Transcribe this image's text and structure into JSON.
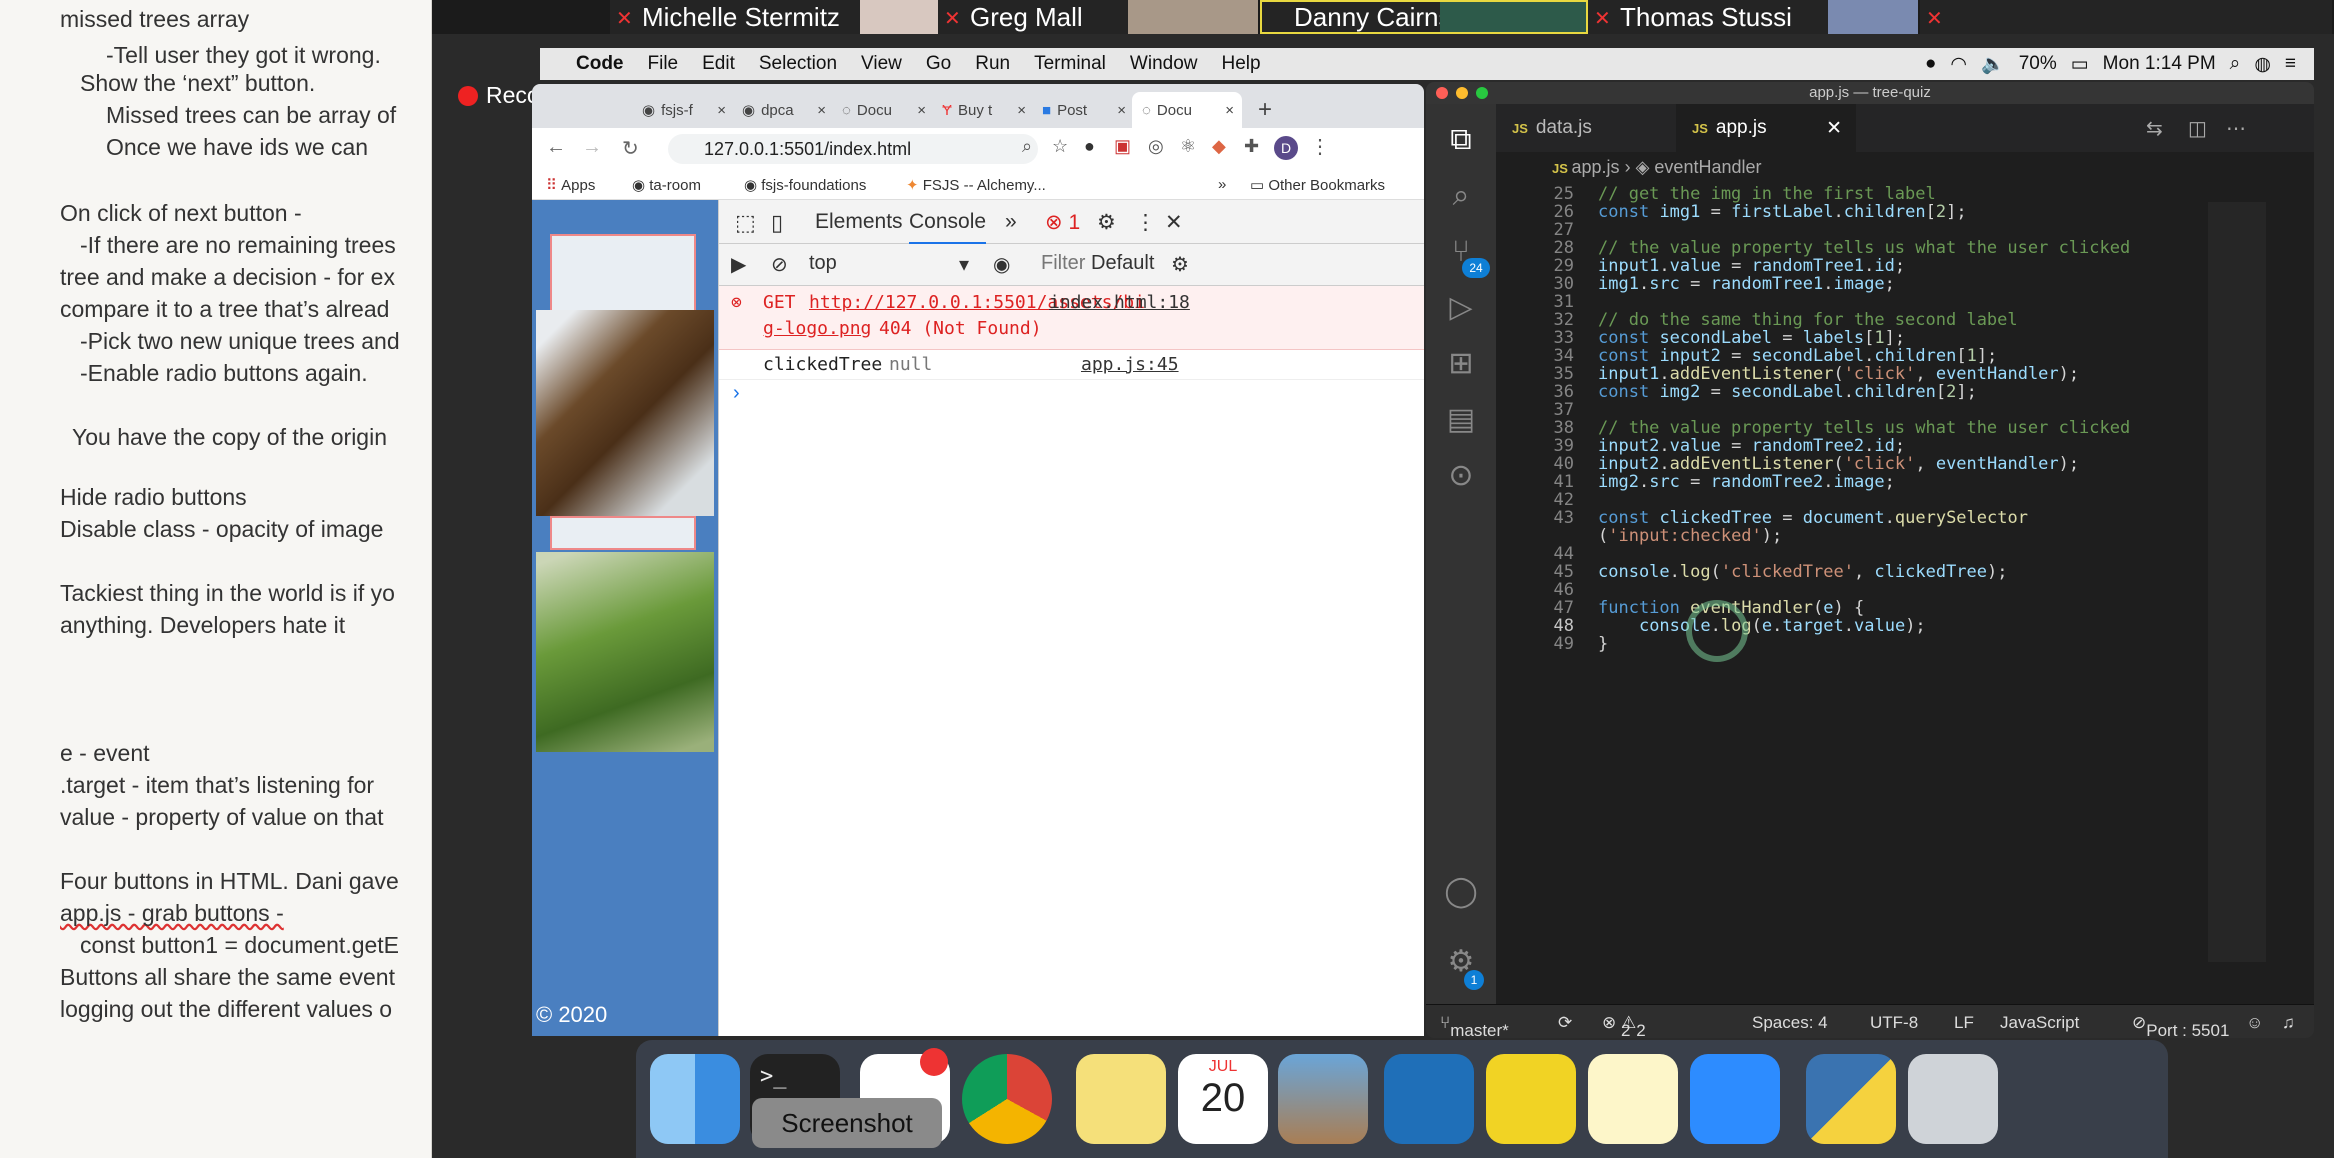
{
  "notes": {
    "lines": [
      "missed trees array",
      "-Tell user they got it wrong.",
      "Show the ‘next” button.",
      "Missed trees can be array of",
      "Once we have ids we can",
      "On click of next button -",
      "-If there are no remaining trees",
      "tree and make a decision - for ex",
      "compare it to a tree that’s alread",
      "-Pick two new unique trees and",
      "-Enable radio buttons again.",
      "You have the copy of the origin",
      "Hide radio buttons",
      "Disable class - opacity of image",
      "Tackiest thing in the world is if yo",
      "anything. Developers hate it",
      "e - event",
      ".target - item that’s listening for",
      "value - property of value on that",
      "Four buttons in HTML. Dani gave",
      "app.js - grab buttons -",
      "const button1 = document.getE",
      "Buttons all share the same event",
      "logging out the different values o"
    ]
  },
  "zoom": {
    "participants": [
      "Michelle Stermitz",
      "Greg Mall",
      "Danny Cairns",
      "Thomas Stussi"
    ]
  },
  "menubar": {
    "items": [
      "Code",
      "File",
      "Edit",
      "Selection",
      "View",
      "Go",
      "Run",
      "Terminal",
      "Window",
      "Help"
    ],
    "battery": "70%",
    "clock": "Mon 1:14 PM"
  },
  "recording": "Recording",
  "chrome": {
    "tabs": [
      "fsjs-f",
      "dpca",
      "Docu",
      "Buy t",
      "Post",
      "Docu"
    ],
    "url": "127.0.0.1:5501/index.html",
    "bookmarks": [
      "Apps",
      "ta-room",
      "fsjs-foundations",
      "FSJS -- Alchemy...",
      "Other Bookmarks"
    ],
    "page_footer": "© 2020"
  },
  "devtools": {
    "tabs": [
      "Elements",
      "Console"
    ],
    "error_count": "1",
    "context": "top",
    "filter": "Filter",
    "levels": "Default",
    "error": {
      "prefix": "GET",
      "url": "http://127.0.0.1:5501/assets/bi",
      "url2": "g-logo.png",
      "status": "404 (Not Found)",
      "source": "index.html:18"
    },
    "log": {
      "text": "clickedTree",
      "value": "null",
      "source": "app.js:45"
    },
    "prompt": "›"
  },
  "vscode": {
    "title": "app.js — tree-quiz",
    "tabs": [
      "data.js",
      "app.js"
    ],
    "crumbs": [
      "app.js",
      "eventHandler"
    ],
    "scm_badge": "24",
    "settings_badge": "1",
    "status": {
      "branch": "master*",
      "problems": "2",
      "warnings": "2",
      "spaces": "Spaces: 4",
      "encoding": "UTF-8",
      "eol": "LF",
      "language": "JavaScript",
      "port": "Port : 5501"
    }
  },
  "dock": {
    "tooltip": "Screenshot",
    "calendar_month": "JUL",
    "calendar_day": "20"
  }
}
